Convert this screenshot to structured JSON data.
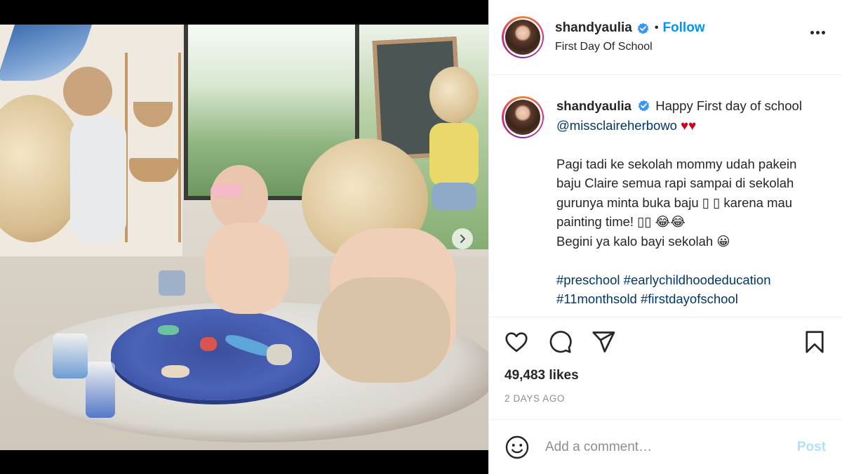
{
  "post": {
    "username": "shandyaulia",
    "follow_label": "Follow",
    "separator": "•",
    "location": "First Day Of School",
    "caption": {
      "username": "shandyaulia",
      "line1_text": "Happy First day of school ",
      "mention": "@missclaireherbowo",
      "hearts": "♥♥",
      "paragraph2": "Pagi tadi ke sekolah mommy udah pakein baju Claire semua rapi sampai di sekolah gurunya minta buka baju ▯ ▯ karena mau painting time! ▯▯ 😂😂",
      "paragraph2_line2": "Begini ya kalo bayi sekolah 😀",
      "hashtags": [
        "#preschool",
        "#earlychildhoodeducation",
        "#11monthsold",
        "#firstdayofschool"
      ]
    },
    "likes": "49,483 likes",
    "timestamp": "2 DAYS AGO",
    "comment": {
      "placeholder": "Add a comment…",
      "post_label": "Post"
    }
  },
  "icons": {
    "verified": "verified-badge-icon",
    "more": "more-options-icon",
    "like": "heart-icon",
    "comment": "comment-icon",
    "share": "share-icon",
    "save": "bookmark-icon",
    "emoji": "emoji-icon",
    "next": "chevron-right-icon"
  },
  "colors": {
    "accent": "#0095f6",
    "link": "#00376b",
    "muted": "#8e8e8e",
    "post_disabled": "#b2dffc",
    "heart": "#d0021b"
  }
}
